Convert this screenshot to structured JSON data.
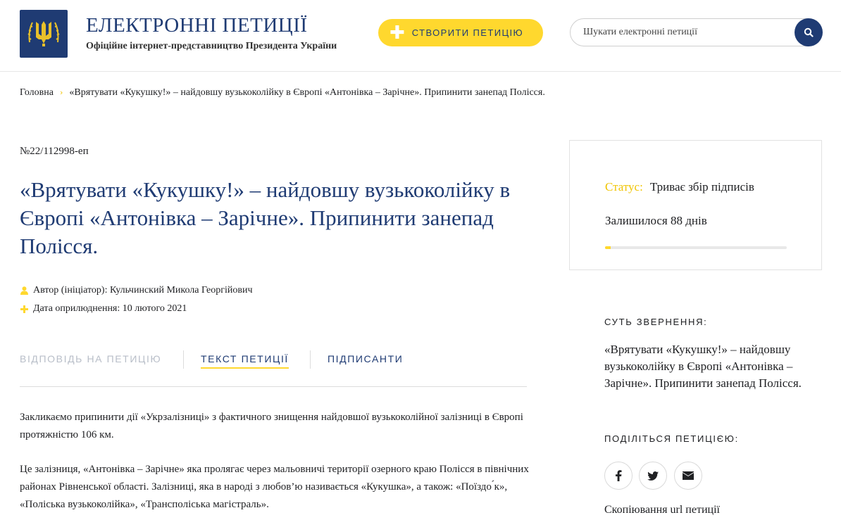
{
  "header": {
    "site_title": "ЕЛЕКТРОННІ ПЕТИЦІЇ",
    "site_subtitle": "Офіційне інтернет-представництво Президента України",
    "create_label": "СТВОРИТИ ПЕТИЦІЮ",
    "search_placeholder": "Шукати електронні петиції"
  },
  "breadcrumb": {
    "home": "Головна",
    "current": "«Врятувати «Кукушку!» – найдовшу вузькоколійку в Європі «Антонівка – Зарічне». Припинити занепад Полісся."
  },
  "petition": {
    "number": "№22/112998-еп",
    "title": "«Врятувати «Кукушку!» – найдовшу вузькоколійку в Європі «Антонівка – Зарічне». Припинити занепад Полісся.",
    "author": "Автор (ініціатор): Кульчинский Микола Георгійович",
    "date": "Дата оприлюднення: 10 лютого 2021",
    "tabs": [
      "ВІДПОВІДЬ НА ПЕТИЦІЮ",
      "ТЕКСТ ПЕТИЦІЇ",
      "ПІДПИСАНТИ"
    ],
    "paragraphs": [
      "Закликаємо припинити дії «Укрзалізниці» з фактичного знищення найдовшої вузькоколійної залізниці в Європі протяжністю 106 км.",
      "Це залізниця, «Антонівка – Зарічне» яка пролягає через мальовничі території озерного краю Полісся в північних районах Рівненської області. Залізниці, яка в народі з любов’ю називається «Кукушка», а також: «Поїздо ́к», «Поліська вузькоколійка», «Трансполіська магістраль»."
    ]
  },
  "status": {
    "label": "Статус:",
    "value": "Триває збір підписів",
    "remaining": "Залишилося 88 днів",
    "progress_fraction": 0.03
  },
  "sidebar": {
    "summary_heading": "СУТЬ ЗВЕРНЕННЯ:",
    "summary_text": "«Врятувати «Кукушку!» – найдовшу вузькоколійку в Європі «Антонівка – Зарічне». Припинити занепад Полісся.",
    "share_heading": "ПОДІЛІТЬСЯ ПЕТИЦІЄЮ:",
    "share_icons": [
      "facebook-icon",
      "twitter-icon",
      "envelope-icon"
    ],
    "copy_url": "Скопіювання url петиції"
  },
  "colors": {
    "brand_blue": "#1f3b73",
    "accent_yellow": "#ffd82e"
  }
}
